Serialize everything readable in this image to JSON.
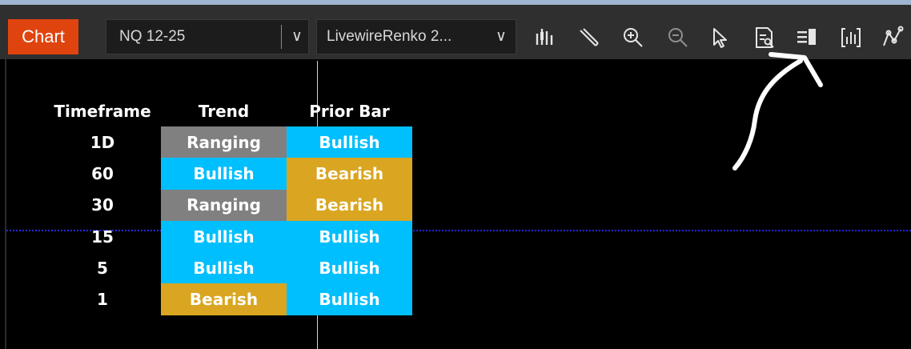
{
  "toolbar": {
    "chart_tab": "Chart",
    "instrument": "NQ 12-25",
    "instrument_dropdown_glyph": "∨",
    "bar_type": "LivewireRenko 2...",
    "bar_type_dropdown_glyph": "∨",
    "tools": [
      "bar-style-icon",
      "draw-pencil-icon",
      "zoom-in-icon",
      "zoom-out-icon",
      "pointer-icon",
      "data-box-icon",
      "properties-panel-icon",
      "indicators-icon",
      "strategies-icon"
    ]
  },
  "table": {
    "headers": {
      "timeframe": "Timeframe",
      "trend": "Trend",
      "prior_bar": "Prior Bar"
    },
    "rows": [
      {
        "timeframe": "1D",
        "trend": "Ranging",
        "prior_bar": "Bullish"
      },
      {
        "timeframe": "60",
        "trend": "Bullish",
        "prior_bar": "Bearish"
      },
      {
        "timeframe": "30",
        "trend": "Ranging",
        "prior_bar": "Bearish"
      },
      {
        "timeframe": "15",
        "trend": "Bullish",
        "prior_bar": "Bullish"
      },
      {
        "timeframe": "5",
        "trend": "Bullish",
        "prior_bar": "Bullish"
      },
      {
        "timeframe": "1",
        "trend": "Bearish",
        "prior_bar": "Bullish"
      }
    ]
  },
  "colors": {
    "Bullish": "#00bfff",
    "Bearish": "#daa520",
    "Ranging": "#808080",
    "chart_tab": "#e0440e",
    "horizontal_line": "#2525e8"
  }
}
